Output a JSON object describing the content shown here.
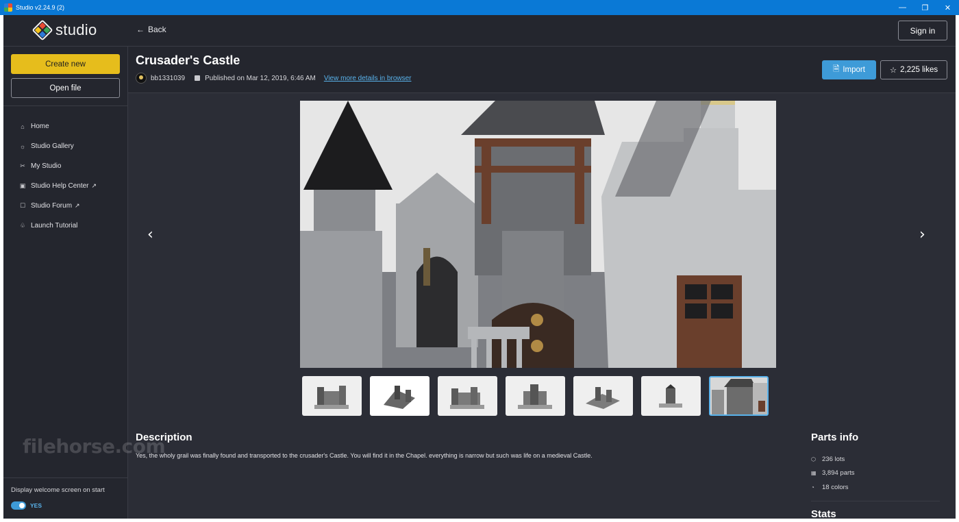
{
  "window": {
    "title": "Studio v2.24.9 (2)",
    "controls": {
      "minimize": "—",
      "restore": "❐",
      "close": "✕"
    }
  },
  "header": {
    "logo_text": "studio",
    "back_label": "Back",
    "signin_label": "Sign in",
    "logo_colors": [
      "#e94b35",
      "#3aa757",
      "#f5c31a",
      "#2d7bd8"
    ]
  },
  "sidebar": {
    "create_label": "Create new",
    "open_label": "Open file",
    "items": [
      {
        "label": "Home",
        "icon": "home-icon",
        "external": false
      },
      {
        "label": "Studio Gallery",
        "icon": "gallery-icon",
        "external": false
      },
      {
        "label": "My Studio",
        "icon": "tools-icon",
        "external": false
      },
      {
        "label": "Studio Help Center",
        "icon": "help-icon",
        "external": true
      },
      {
        "label": "Studio Forum",
        "icon": "chat-icon",
        "external": true
      },
      {
        "label": "Launch Tutorial",
        "icon": "tutorial-icon",
        "external": false
      }
    ],
    "external_glyph": "↗",
    "welcome_label": "Display welcome screen on start",
    "welcome_toggle_label": "YES",
    "welcome_enabled": true
  },
  "watermark": "filehorse.com",
  "model": {
    "title": "Crusader's Castle",
    "author": "bb1331039",
    "published": "Published on Mar 12, 2019, 6:46 AM",
    "details_link": "View more details in browser",
    "import_label": "Import",
    "likes_label": "2,225 likes"
  },
  "gallery": {
    "thumbnail_count": 7,
    "active_index": 6
  },
  "description": {
    "title": "Description",
    "text": "Yes, the wholy grail was finally found and transported to the crusader's Castle. You will find it in the Chapel. everything is narrow but such was life on a medieval Castle."
  },
  "parts": {
    "title": "Parts info",
    "items": [
      {
        "label": "236 lots",
        "icon": "cube-icon"
      },
      {
        "label": "3,894 parts",
        "icon": "bricks-icon"
      },
      {
        "label": "18 colors",
        "icon": "palette-icon"
      }
    ]
  },
  "stats": {
    "title": "Stats"
  },
  "colors": {
    "accent_yellow": "#e6bd1c",
    "accent_blue": "#3e9bd8",
    "link_blue": "#59b3ec",
    "background": "#2b2d36",
    "panel": "#24262e"
  }
}
